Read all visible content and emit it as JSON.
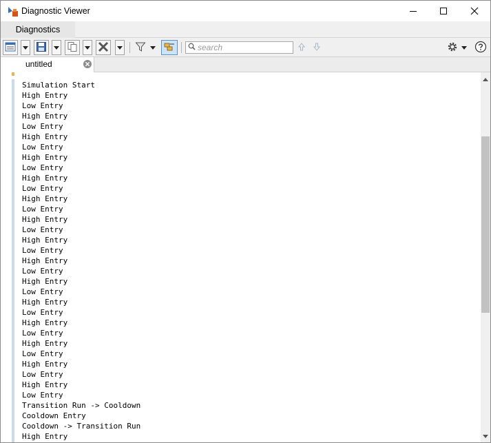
{
  "window": {
    "title": "Diagnostic Viewer"
  },
  "ribbon": {
    "tab_label": "Diagnostics"
  },
  "toolbar": {
    "search_placeholder": "search",
    "icons": [
      "report-view-icon",
      "save-icon",
      "copy-icon",
      "clear-icon",
      "filter-icon",
      "group-icon",
      "arrow-up-icon",
      "arrow-down-icon",
      "gear-icon",
      "help-icon"
    ]
  },
  "doc_tab": {
    "label": "untitled"
  },
  "log": {
    "lines": [
      "Simulation Start",
      "High Entry",
      "Low Entry",
      "High Entry",
      "Low Entry",
      "High Entry",
      "Low Entry",
      "High Entry",
      "Low Entry",
      "High Entry",
      "Low Entry",
      "High Entry",
      "Low Entry",
      "High Entry",
      "Low Entry",
      "High Entry",
      "Low Entry",
      "High Entry",
      "Low Entry",
      "High Entry",
      "Low Entry",
      "High Entry",
      "Low Entry",
      "High Entry",
      "Low Entry",
      "High Entry",
      "Low Entry",
      "High Entry",
      "Low Entry",
      "High Entry",
      "Low Entry",
      "Transition Run -> Cooldown",
      "Cooldown Entry",
      "Cooldown -> Transition Run",
      "High Entry"
    ]
  },
  "colors": {
    "accent_bar": "#c7dcef",
    "active_button": "#cde3f7",
    "help_blue": "#3c6fb5"
  }
}
